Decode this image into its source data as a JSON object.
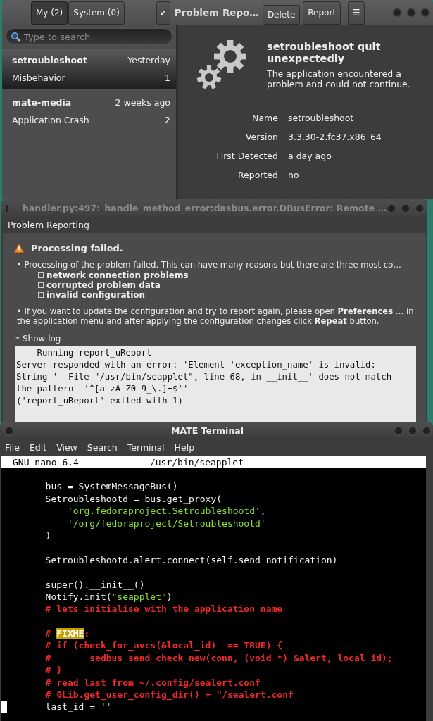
{
  "problem_window": {
    "tabs": [
      {
        "label": "My (2)",
        "selected": true
      },
      {
        "label": "System (0)",
        "selected": false
      }
    ],
    "check_button": "✔",
    "title": "Problem Repo…",
    "actions": [
      {
        "label": "Delete",
        "kind": "delete"
      },
      {
        "label": "Report",
        "kind": "report"
      }
    ],
    "menu_button": "☰",
    "search": {
      "placeholder": "Type to search"
    },
    "problems": [
      {
        "name": "setroubleshoot",
        "time": "Yesterday",
        "type": "Misbehavior",
        "count": "1",
        "selected": true
      },
      {
        "name": "mate-media",
        "time": "2 weeks ago",
        "type": "Application Crash",
        "count": "2",
        "selected": false
      }
    ],
    "detail": {
      "heading": "setroubleshoot quit unexpectedly",
      "message": "The application encountered a problem and could not continue.",
      "fields": [
        {
          "label": "Name",
          "value": "setroubleshoot"
        },
        {
          "label": "Version",
          "value": "3.3.30-2.fc37.x86_64"
        },
        {
          "label": "First Detected",
          "value": "a day ago"
        },
        {
          "label": "Reported",
          "value": "no"
        }
      ]
    }
  },
  "error_dialog": {
    "title": "handler.py:497:_handle_method_error:dasbus.error.DBusError: Remote …",
    "header": "Problem Reporting",
    "heading": "Processing failed.",
    "paragraphs": [
      {
        "text": "• Processing of the problem failed. This can have many reasons but there are three most co…",
        "items": [
          "network connection problems",
          "corrupted problem data",
          "invalid configuration"
        ]
      },
      {
        "text": "• If you want to update the configuration and try to report again, please open **Preferences** … in the application menu and after applying the configuration changes click **Repeat** button."
      }
    ],
    "log_toggle": {
      "label": "Show log",
      "expanded": true
    },
    "log": [
      "--- Running report_uReport ---",
      "Server responded with an error: 'Element 'exception_name' is invalid:",
      "String '  File \"/usr/bin/seapplet\", line 68, in __init__' does not match",
      "the pattern  '^[a-zA-Z0-9_\\.]+$''",
      "('report_uReport' exited with 1)"
    ]
  },
  "terminal": {
    "title": "MATE Terminal",
    "menu": [
      "File",
      "Edit",
      "View",
      "Search",
      "Terminal",
      "Help"
    ],
    "nano_version": "GNU nano 6.4",
    "nano_file": "/usr/bin/seapplet",
    "lines": [
      {
        "kind": "blank",
        "cursor": false
      },
      {
        "kind": "code",
        "cursor": false,
        "segments": [
          {
            "text": "        bus = SystemMessageBus()",
            "kind": "plain"
          }
        ]
      },
      {
        "kind": "code",
        "cursor": false,
        "segments": [
          {
            "text": "        Setroubleshootd = bus.get_proxy(",
            "kind": "plain"
          }
        ]
      },
      {
        "kind": "code",
        "cursor": false,
        "segments": [
          {
            "text": "            'org.fedoraproject.Setroubleshootd'",
            "kind": "string"
          },
          {
            "text": ",",
            "kind": "plain"
          }
        ]
      },
      {
        "kind": "code",
        "cursor": false,
        "segments": [
          {
            "text": "            '/org/fedoraproject/Setroubleshootd'",
            "kind": "string"
          }
        ]
      },
      {
        "kind": "code",
        "cursor": false,
        "segments": [
          {
            "text": "        )",
            "kind": "plain"
          }
        ]
      },
      {
        "kind": "blank",
        "cursor": false
      },
      {
        "kind": "code",
        "cursor": false,
        "segments": [
          {
            "text": "        Setroubleshootd.alert.connect(self.send_notification)",
            "kind": "plain"
          }
        ]
      },
      {
        "kind": "blank",
        "cursor": false
      },
      {
        "kind": "code",
        "cursor": false,
        "segments": [
          {
            "text": "        super().__init__()",
            "kind": "plain"
          }
        ]
      },
      {
        "kind": "code",
        "cursor": false,
        "segments": [
          {
            "text": "        Notify.init(",
            "kind": "plain"
          },
          {
            "text": "\"seapplet\"",
            "kind": "string"
          },
          {
            "text": ")",
            "kind": "plain"
          }
        ]
      },
      {
        "kind": "code",
        "cursor": false,
        "segments": [
          {
            "text": "        # lets initialise with the application name",
            "kind": "comment"
          }
        ]
      },
      {
        "kind": "blank",
        "cursor": false
      },
      {
        "kind": "code",
        "cursor": false,
        "segments": [
          {
            "text": "        # ",
            "kind": "comment"
          },
          {
            "text": "FIXME",
            "kind": "highlight"
          },
          {
            "text": ":",
            "kind": "comment"
          }
        ]
      },
      {
        "kind": "code",
        "cursor": false,
        "segments": [
          {
            "text": "        # if (check_for_avcs(&local_id)  == TRUE) {",
            "kind": "comment"
          }
        ]
      },
      {
        "kind": "code",
        "cursor": false,
        "segments": [
          {
            "text": "        #       sedbus_send_check_new(conn, (void *) &alert, local_id);",
            "kind": "comment"
          }
        ]
      },
      {
        "kind": "code",
        "cursor": false,
        "segments": [
          {
            "text": "        # }",
            "kind": "comment"
          }
        ]
      },
      {
        "kind": "code",
        "cursor": false,
        "segments": [
          {
            "text": "        # read last from ~/.config/sealert.conf",
            "kind": "comment"
          }
        ]
      },
      {
        "kind": "code",
        "cursor": false,
        "segments": [
          {
            "text": "        # GLib.get_user_config_dir() + \"/sealert.conf",
            "kind": "comment"
          }
        ]
      },
      {
        "kind": "code",
        "cursor": true,
        "segments": [
          {
            "text": "        last_id = ",
            "kind": "plain"
          },
          {
            "text": "''",
            "kind": "string"
          }
        ]
      }
    ]
  }
}
